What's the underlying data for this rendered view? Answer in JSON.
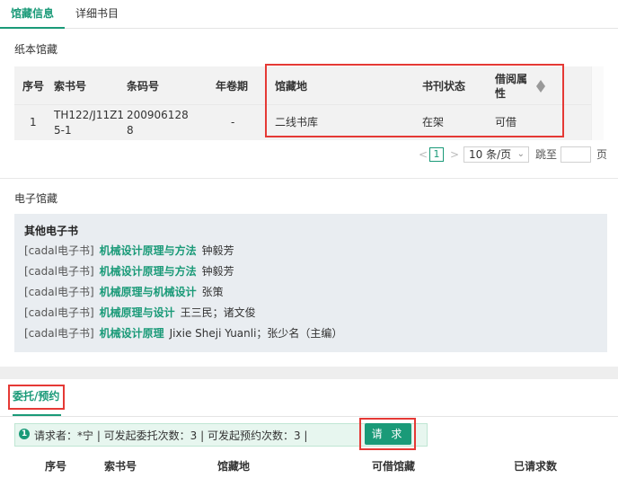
{
  "tabs": [
    {
      "label": "馆藏信息"
    },
    {
      "label": "详细书目"
    }
  ],
  "print_section": {
    "title": "纸本馆藏",
    "headers": [
      "序号",
      "索书号",
      "条码号",
      "年卷期",
      "馆藏地",
      "书刊状态",
      "借阅属性"
    ],
    "rows": [
      {
        "index": "1",
        "call_no_l1": "TH122/J11Z1",
        "call_no_l2": "5-1",
        "barcode_l1": "200906128",
        "barcode_l2": "8",
        "volume": "-",
        "location": "二线书库",
        "status": "在架",
        "loan": "可借"
      }
    ]
  },
  "pager": {
    "prev": "<",
    "current": "1",
    "next": ">",
    "page_size": "10 条/页",
    "jump_label": "跳至",
    "page_suffix": "页"
  },
  "ebook_section": {
    "title": "电子馆藏",
    "box_title": "其他电子书",
    "items": [
      {
        "source": "[cadal电子书]",
        "title": "机械设计原理与方法",
        "author": "钟毅芳"
      },
      {
        "source": "[cadal电子书]",
        "title": "机械设计原理与方法",
        "author": "钟毅芳"
      },
      {
        "source": "[cadal电子书]",
        "title": "机械原理与机械设计",
        "author": "张策"
      },
      {
        "source": "[cadal电子书]",
        "title": "机械原理与设计",
        "author": "王三民；诸文俊"
      },
      {
        "source": "[cadal电子书]",
        "title": "机械设计原理",
        "author": "Jixie Sheji Yuanli；张少名（主编）"
      }
    ]
  },
  "request_section": {
    "tab_label": "委托/预约",
    "notice_icon": "1",
    "notice": "请求者：*宁    |    可发起委托次数：3    |    可发起预约次数：3    |",
    "button": "请 求",
    "headers": [
      "序号",
      "索书号",
      "馆藏地",
      "可借馆藏",
      "已请求数"
    ]
  },
  "colors": {
    "accent": "#1a9a78",
    "highlight": "#e53935"
  }
}
